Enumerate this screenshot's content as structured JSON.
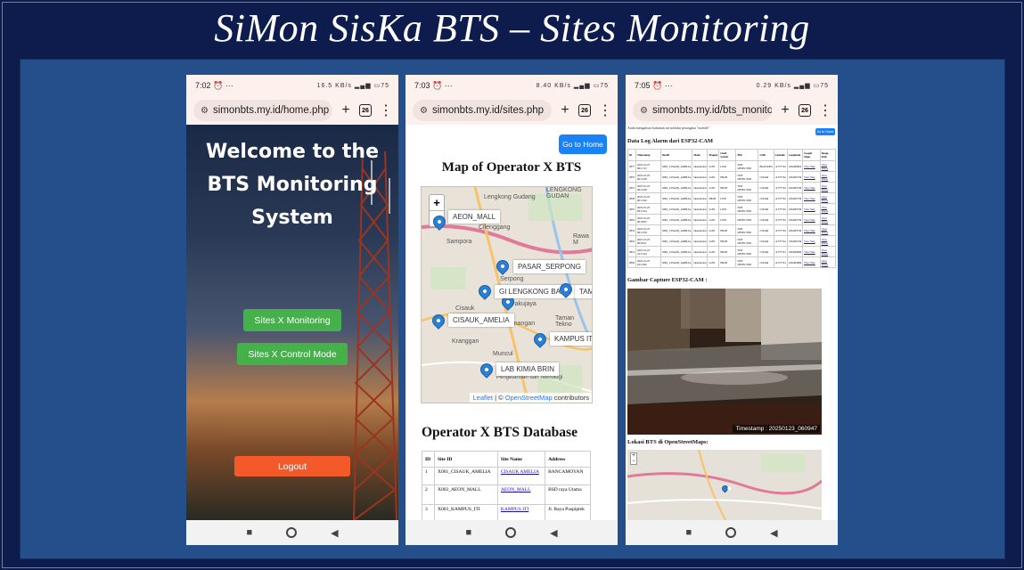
{
  "title": "SiMon SisKa BTS – Sites Monitoring",
  "phone1": {
    "time": "7:02",
    "status_right": "16.5 KB/s",
    "battery": "75",
    "url": "simonbts.my.id/home.php",
    "tab_count": "26",
    "heading": [
      "Welcome to the",
      "BTS Monitoring",
      "System"
    ],
    "btn_monitoring": "Sites X Monitoring",
    "btn_control": "Sites X Control Mode",
    "btn_logout": "Logout"
  },
  "phone2": {
    "time": "7:03",
    "status_right": "8.40 KB/s",
    "battery": "75",
    "url": "simonbts.my.id/sites.php",
    "tab_count": "26",
    "go_home": "Go to Home",
    "map_title": "Map of Operator X BTS",
    "map_places": [
      "Lengkong Gudang",
      "LENGKONG GUDAN",
      "Cilenggang",
      "Rawa M",
      "Sampora",
      "Serpong",
      "Cisauk",
      "Pakujaya",
      "Kranggan",
      "demangan",
      "Muncul",
      "Taman Tekno",
      "Pusat Penelitian Ilmu Pengetahuan dan Teknologi"
    ],
    "markers": [
      "AEON_MALL",
      "PASAR_SERPONG",
      "GI LENGKONG BARU",
      "TAM",
      "CISAUK_AMELIA",
      "KAMPUS ITI",
      "LAB KIMIA BRIN"
    ],
    "attribution_leaflet": "Leaflet",
    "attribution_sep": "| ©",
    "attribution_osm": "OpenStreetMap",
    "attribution_tail": "contributors",
    "db_title": "Operator X BTS Database",
    "table_headers": [
      "ID",
      "Site ID",
      "Site Name",
      "Address"
    ],
    "table_rows": [
      [
        "1",
        "X001_CISAUK_AMELIA",
        "CISAUK AMELIA",
        "BANCAMOYAN"
      ],
      [
        "2",
        "X002_AEON_MALL",
        "AEON_MALL",
        "BSD raya Utama"
      ],
      [
        "3",
        "X003_KAMPUS_ITI",
        "KAMPUS ITI",
        "Jl. Raya Puspiptek"
      ]
    ]
  },
  "phone3": {
    "time": "7:05",
    "status_right": "0.29 KB/s",
    "battery": "75",
    "url": "simonbts.my.id/bts_monito",
    "tab_count": "26",
    "login_note": "Anda mengakses halaman ini melalui perangkat \"mobile\"",
    "go_home": "Go to Home",
    "log_title": "Data Log Alarm dari ESP32-CAM",
    "log_headers": [
      "ID",
      "Timestamp",
      "SiteID",
      "Mode",
      "Magnet",
      "Limit Switch",
      "PIR",
      "LDR",
      "Latitude",
      "Longitude",
      "Google Maps",
      "Image Path"
    ],
    "log_rows": [
      [
        "2877",
        "2025-01-23 06:11:15",
        "X001_CISAUK_AMELIA",
        "Operational",
        "LOW",
        "LOW",
        "NOT DETECTED",
        "BLOCKED",
        "-6.377722",
        "106.665802",
        "View Map",
        "View Image"
      ],
      [
        "2876",
        "2025-01-23 06:14:38",
        "X001_CISAUK_AMELIA",
        "Operational",
        "LOW",
        "HIGH",
        "NOT DETECTED",
        "CLEAR",
        "-6.377722",
        "106.663736",
        "View Map",
        "View Image"
      ],
      [
        "2875",
        "2025-01-23 06:14:38",
        "X001_CISAUK_AMELIA",
        "Operational",
        "LOW",
        "HIGH",
        "NOT DETECTED",
        "CLEAR",
        "-6.377722",
        "106.663736",
        "View Map",
        "View Image"
      ],
      [
        "2858",
        "2025-01-23 06:13:40",
        "X001_CISAUK_AMELIA",
        "Operational",
        "HIGH",
        "LOW",
        "NOT DETECTED",
        "CLEAR",
        "-6.377722",
        "106.663736",
        "View Map",
        "View Image"
      ],
      [
        "2855",
        "2025-01-23 06:13:24",
        "X001_CISAUK_AMELIA",
        "Operational",
        "LOW",
        "LOW",
        "NOT DETECTED",
        "CLEAR",
        "-6.377722",
        "106.663736",
        "View Map",
        "View Image"
      ],
      [
        "2854",
        "2025-01-23 06:18:05",
        "X001_CISAUK_AMELIA",
        "Operational",
        "LOW",
        "LOW",
        "DETECTED",
        "CLEAR",
        "-6.377722",
        "106.663736",
        "View Map",
        "View Image"
      ],
      [
        "2853",
        "2025-01-23 06:13:58",
        "X001_CISAUK_AMELIA",
        "Operational",
        "LOW",
        "HIGH",
        "NOT DETECTED",
        "CLEAR",
        "-6.377722",
        "106.663736",
        "View Map",
        "View Image"
      ],
      [
        "2852",
        "2025-01-23 06:03:51",
        "X001_CISAUK_AMELIA",
        "Operational",
        "LOW",
        "HIGH",
        "NOT DETECTED",
        "CLEAR",
        "-6.377722",
        "106.663736",
        "View Map",
        "View Image"
      ],
      [
        "2851",
        "2025-01-23 22:15:44",
        "X001_CISAUK_AMELIA",
        "Operational",
        "LOW",
        "HIGH",
        "NOT DETECTED",
        "CLEAR",
        "-6.377741",
        "106.663669",
        "View Map",
        "View Image"
      ],
      [
        "2850",
        "2025-01-23 22:13:00",
        "X001_CISAUK_AMELIA",
        "Operational",
        "LOW",
        "HIGH",
        "NOT DETECTED",
        "CLEAR",
        "-6.377741",
        "106.663669",
        "View Map",
        "View Image"
      ]
    ],
    "capture_title": "Gambar Capture ESP32-CAM :",
    "timestamp_label": "Timestamp : 20250123_060947",
    "osm_title": "Lokasi BTS di OpenStreetMaps:"
  }
}
